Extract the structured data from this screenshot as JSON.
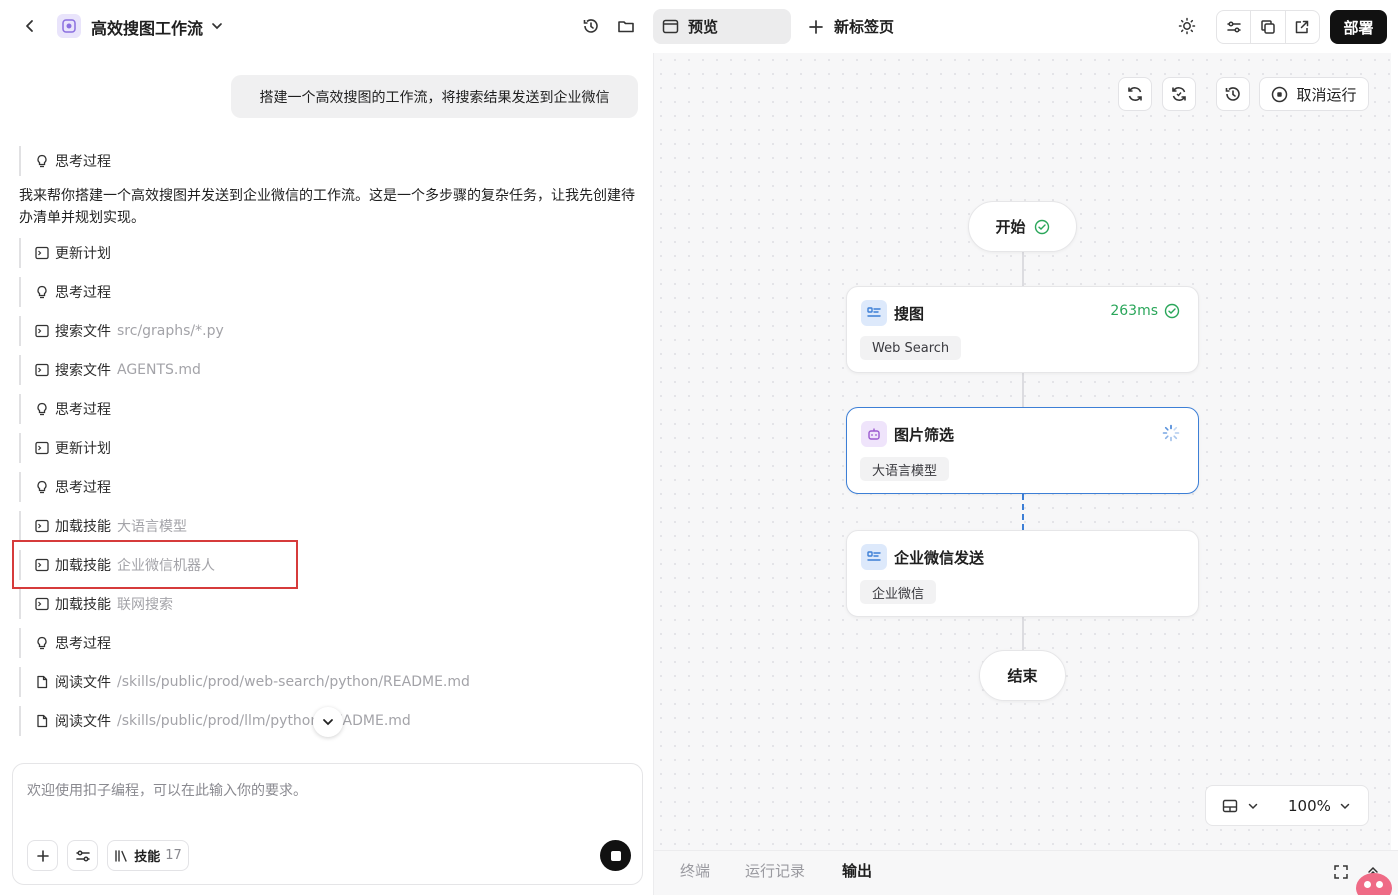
{
  "header": {
    "app_title": "高效搜图工作流",
    "preview_tab": "预览",
    "new_tab": "新标签页",
    "deploy": "部署"
  },
  "chat": {
    "user_message": "搭建一个高效搜图的工作流，将搜索结果发送到企业微信",
    "assistant_text": "我来帮你搭建一个高效搜图并发送到企业微信的工作流。这是一个多步骤的复杂任务，让我先创建待办清单并规划实现。",
    "steps": [
      {
        "icon": "bulb-icon",
        "label": "思考过程",
        "detail": ""
      },
      {
        "icon": "terminal-icon",
        "label": "更新计划",
        "detail": ""
      },
      {
        "icon": "bulb-icon",
        "label": "思考过程",
        "detail": ""
      },
      {
        "icon": "terminal-icon",
        "label": "搜索文件",
        "detail": "src/graphs/*.py"
      },
      {
        "icon": "terminal-icon",
        "label": "搜索文件",
        "detail": "AGENTS.md"
      },
      {
        "icon": "bulb-icon",
        "label": "思考过程",
        "detail": ""
      },
      {
        "icon": "terminal-icon",
        "label": "更新计划",
        "detail": ""
      },
      {
        "icon": "bulb-icon",
        "label": "思考过程",
        "detail": ""
      },
      {
        "icon": "terminal-icon",
        "label": "加载技能",
        "detail": "大语言模型"
      },
      {
        "icon": "terminal-icon",
        "label": "加载技能",
        "detail": "企业微信机器人"
      },
      {
        "icon": "terminal-icon",
        "label": "加载技能",
        "detail": "联网搜索"
      },
      {
        "icon": "bulb-icon",
        "label": "思考过程",
        "detail": ""
      },
      {
        "icon": "file-icon",
        "label": "阅读文件",
        "detail": "/skills/public/prod/web-search/python/README.md"
      },
      {
        "icon": "file-icon",
        "label": "阅读文件",
        "detail": "/skills/public/prod/llm/python/README.md"
      }
    ]
  },
  "input": {
    "placeholder": "欢迎使用扣子编程，可以在此输入你的要求。",
    "skill_label": "技能",
    "skill_count": "17"
  },
  "canvas": {
    "cancel_run": "取消运行",
    "start_node": "开始",
    "end_node": "结束",
    "nodes": [
      {
        "title": "搜图",
        "tag": "Web Search",
        "status": "263ms"
      },
      {
        "title": "图片筛选",
        "tag": "大语言模型",
        "status": ""
      },
      {
        "title": "企业微信发送",
        "tag": "企业微信",
        "status": ""
      }
    ],
    "zoom": "100%"
  },
  "bottom_tabs": [
    "终端",
    "运行记录",
    "输出"
  ],
  "colors": {
    "accent_blue": "#3d7fd6",
    "success_green": "#2aa65a",
    "highlight_red": "#d63b3b"
  }
}
